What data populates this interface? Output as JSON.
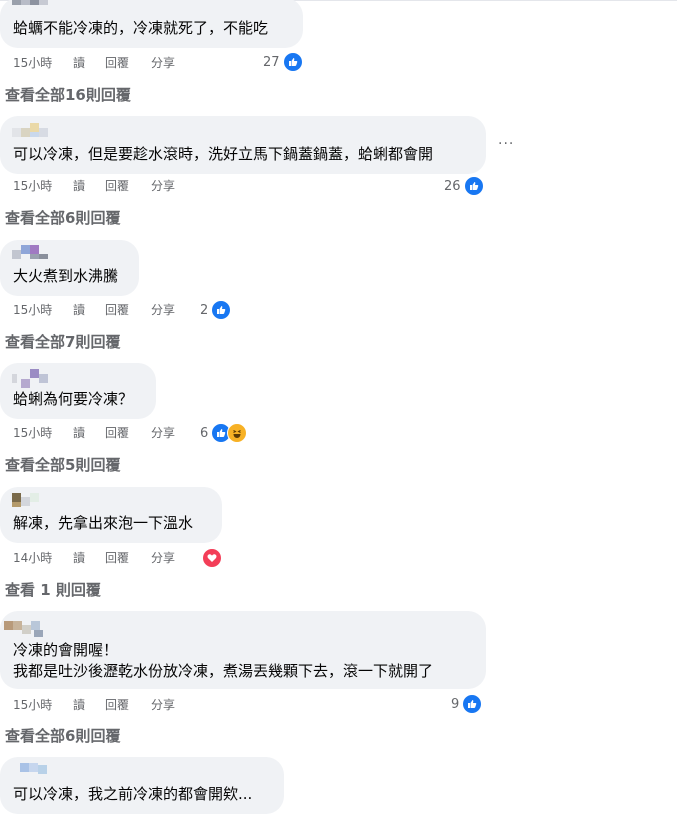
{
  "comments": [
    {
      "lines": [
        "蛤蠣不能冷凍的，冷凍就死了，不能吃"
      ],
      "time": "15小時",
      "reactions": {
        "count": "27",
        "types": [
          "like"
        ]
      },
      "view_all": "查看全部16則回覆"
    },
    {
      "lines": [
        "可以冷凍，但是要趁水滾時，洗好立馬下鍋蓋鍋蓋，蛤蜊都會開"
      ],
      "time": "15小時",
      "reactions": {
        "count": "26",
        "types": [
          "like"
        ]
      },
      "view_all": "查看全部6則回覆"
    },
    {
      "lines": [
        "大火煮到水沸騰"
      ],
      "time": "15小時",
      "reactions": {
        "count": "2",
        "types": [
          "like"
        ]
      },
      "view_all": "查看全部7則回覆"
    },
    {
      "lines": [
        "蛤蜊為何要冷凍？"
      ],
      "time": "15小時",
      "reactions": {
        "count": "6",
        "types": [
          "like",
          "haha"
        ]
      },
      "view_all": "查看全部5則回覆"
    },
    {
      "lines": [
        "解凍，先拿出來泡一下溫水"
      ],
      "time": "14小時",
      "reactions": {
        "count": "",
        "types": [
          "love"
        ]
      },
      "view_all": "查看 1 則回覆"
    },
    {
      "lines": [
        "冷凍的會開喔！",
        "我都是吐沙後瀝乾水份放冷凍，煮湯丟幾顆下去，滾一下就開了"
      ],
      "time": "15小時",
      "reactions": {
        "count": "9",
        "types": [
          "like"
        ]
      },
      "view_all": "查看全部6則回覆"
    },
    {
      "lines": [
        "可以冷凍，我之前冷凍的都會開欸..."
      ],
      "time": "",
      "reactions": {
        "count": "",
        "types": []
      },
      "view_all": ""
    }
  ],
  "actions": {
    "read": "讀",
    "reply": "回覆",
    "share": "分享"
  },
  "more_options": "···",
  "colors": {
    "bubble": "#f0f2f5",
    "like": "#1877f2",
    "love": "#f33e58",
    "haha": "#f7b125",
    "meta": "#65676b"
  }
}
